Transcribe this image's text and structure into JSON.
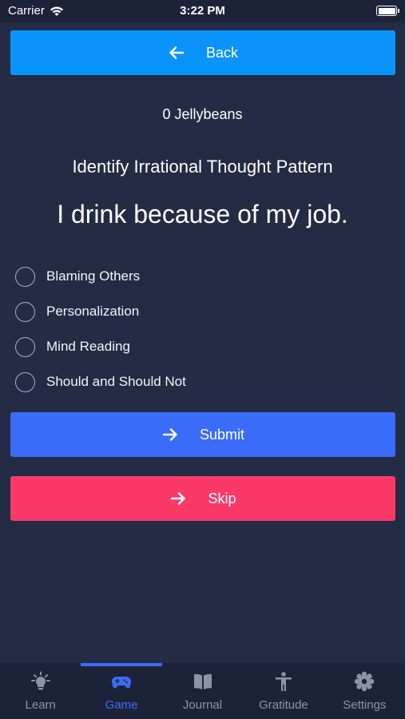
{
  "status_bar": {
    "carrier": "Carrier",
    "time": "3:22 PM"
  },
  "back_button": {
    "label": "Back"
  },
  "jellybeans": "0 Jellybeans",
  "subtitle": "Identify Irrational Thought Pattern",
  "statement": "I drink because of my job.",
  "options": [
    {
      "label": "Blaming Others"
    },
    {
      "label": "Personalization"
    },
    {
      "label": "Mind Reading"
    },
    {
      "label": "Should and Should Not"
    }
  ],
  "submit_button": {
    "label": "Submit"
  },
  "skip_button": {
    "label": "Skip"
  },
  "tabs": [
    {
      "label": "Learn",
      "icon": "lightbulb-icon"
    },
    {
      "label": "Game",
      "icon": "gamepad-icon",
      "active": true
    },
    {
      "label": "Journal",
      "icon": "book-icon"
    },
    {
      "label": "Gratitude",
      "icon": "person-icon"
    },
    {
      "label": "Settings",
      "icon": "gear-icon"
    }
  ],
  "colors": {
    "background": "#232c44",
    "back_button": "#0a93fb",
    "submit_button": "#3b6cf8",
    "skip_button": "#fb3969",
    "tab_active": "#3b6cf8",
    "tab_inactive": "#8b93a8"
  }
}
